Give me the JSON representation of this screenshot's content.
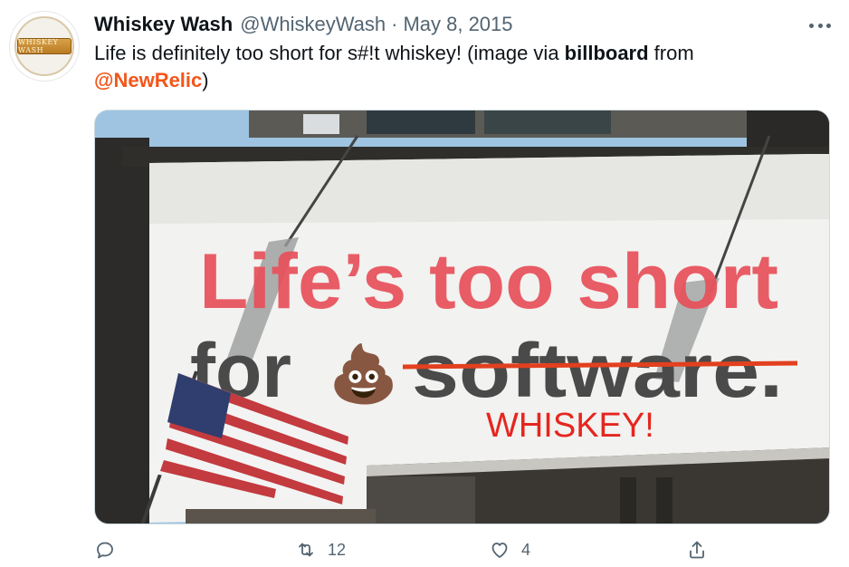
{
  "tweet": {
    "author_name": "Whiskey Wash",
    "handle": "@WhiskeyWash",
    "separator": "·",
    "date": "May 8, 2015",
    "text_part1": "Life is definitely too short for s#!t whiskey!  (image via ",
    "text_bold": "billboard",
    "text_part2": " from",
    "mention": "@NewRelic",
    "text_part3": ")",
    "avatar_label": "WHISKEY WASH"
  },
  "media": {
    "billboard_line1": "Life’s too short",
    "billboard_for": "for",
    "billboard_struck": "software.",
    "billboard_handwritten": "WHISKEY!",
    "billboard_emoji": "💩"
  },
  "actions": {
    "retweet_count": "12",
    "like_count": "4"
  },
  "colors": {
    "accent": "#f4551a",
    "billboard_red": "#e8505a",
    "billboard_dark": "#4a4a4a",
    "secondary_text": "#536471"
  }
}
